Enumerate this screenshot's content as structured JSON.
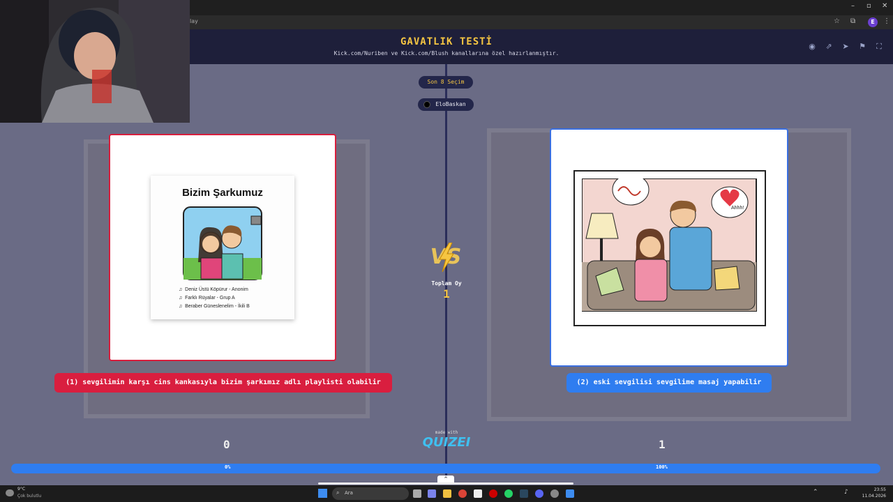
{
  "browser": {
    "url_fragment": "lay",
    "profile_initial": "E"
  },
  "header": {
    "title": "GAVATLIK TESTİ",
    "subtitle": "Kick.com/Nuriben ve Kick.com/Blush kanallarına özel hazırlanmıştır.",
    "icons": [
      "eye-icon",
      "external-link-icon",
      "send-icon",
      "flag-icon",
      "fullscreen-icon"
    ]
  },
  "pills": {
    "last_selection": "Son 8 Seçim",
    "author": "EloBaskan"
  },
  "left_option": {
    "image": {
      "title": "Bizim Şarkumuz",
      "tracks": [
        "Deniz Üstü Köpürur - Anonim",
        "Farklı Rüyalar - Grup A",
        "Beraber Güneslenelim - İkili B"
      ]
    },
    "label": "(1) sevgilimin karşı cins kankasıyla bizim şarkımız adlı playlisti olabilir",
    "score": "0",
    "percent": "0%"
  },
  "right_option": {
    "image": {
      "speech": "Ahhh!"
    },
    "label": "(2) eski sevgilisi sevgilime masaj yapabilir",
    "score": "1",
    "percent": "100%"
  },
  "center": {
    "vs": "VS",
    "total_label": "Toplam Oy",
    "total_value": "1",
    "made_with": "made with",
    "brand": "QUIZEI"
  },
  "progress": {
    "left_fraction": 0.0,
    "right_fraction": 1.0
  },
  "taskbar": {
    "weather_temp": "9°C",
    "weather_desc": "Çok bulutlu",
    "search": "Ara",
    "time": "23:55",
    "date": "11.04.2026"
  },
  "colors": {
    "accent_gold": "#f5c542",
    "left_red": "#d91e3f",
    "right_blue": "#2f7df0",
    "header_bg": "#1e1f3a"
  }
}
